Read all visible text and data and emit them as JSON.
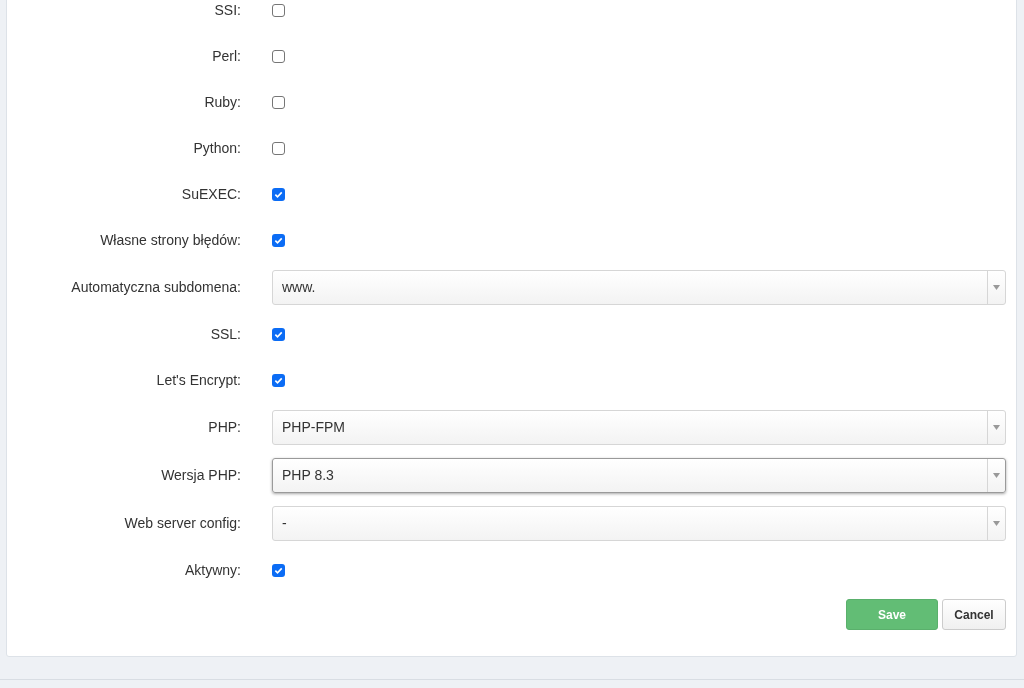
{
  "fields": [
    {
      "kind": "checkbox",
      "label": "SSI:",
      "checked": false
    },
    {
      "kind": "checkbox",
      "label": "Perl:",
      "checked": false
    },
    {
      "kind": "checkbox",
      "label": "Ruby:",
      "checked": false
    },
    {
      "kind": "checkbox",
      "label": "Python:",
      "checked": false
    },
    {
      "kind": "checkbox",
      "label": "SuEXEC:",
      "checked": true
    },
    {
      "kind": "checkbox",
      "label": "Własne strony błędów:",
      "checked": true
    },
    {
      "kind": "select",
      "label": "Automatyczna subdomena:",
      "value": "www.",
      "focused": false
    },
    {
      "kind": "checkbox",
      "label": "SSL:",
      "checked": true
    },
    {
      "kind": "checkbox",
      "label": "Let's Encrypt:",
      "checked": true
    },
    {
      "kind": "select",
      "label": "PHP:",
      "value": "PHP-FPM",
      "focused": false
    },
    {
      "kind": "select",
      "label": "Wersja PHP:",
      "value": "PHP 8.3",
      "focused": true
    },
    {
      "kind": "select",
      "label": "Web server config:",
      "value": "-",
      "focused": false
    },
    {
      "kind": "checkbox",
      "label": "Aktywny:",
      "checked": true
    }
  ],
  "buttons": [
    {
      "kind": "primary",
      "label": "Save"
    },
    {
      "kind": "default",
      "label": "Cancel"
    }
  ]
}
